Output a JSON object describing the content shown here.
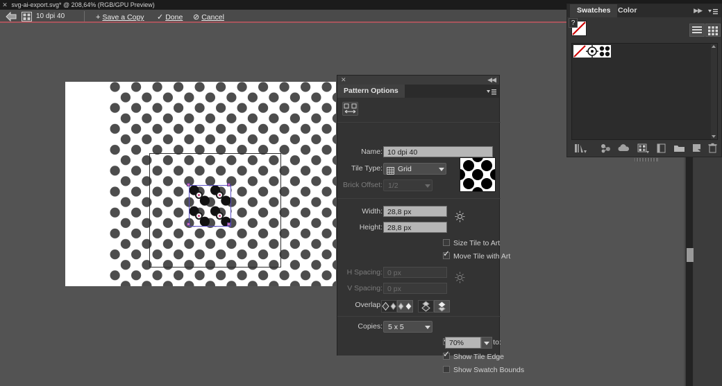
{
  "titlebar": {
    "close_icon": "close-icon",
    "document_title": "svg-ai-export.svg* @ 208,64% (RGB/GPU Preview)"
  },
  "appbar": {
    "back_icon": "back-arrow-icon",
    "tile_icon": "pattern-tile-icon",
    "pattern_name": "10 dpi 40",
    "save_copy_prefix": "+",
    "save_copy_label": "Save a Copy",
    "done_prefix": "✓",
    "done_label": "Done",
    "cancel_prefix": "⊘",
    "cancel_label": "Cancel"
  },
  "pattern_options": {
    "close_icon": "close-icon",
    "collapse_icon": "collapse-panel-icon",
    "tab_label": "Pattern Options",
    "menu_icon": "panel-menu-icon",
    "tile_tool_icon": "tile-edit-tool-icon",
    "name_label": "Name:",
    "name_value": "10 dpi 40",
    "tile_type_label": "Tile Type:",
    "tile_type_value": "Grid",
    "tile_type_icon": "grid-tile-icon",
    "brick_offset_label": "Brick Offset:",
    "brick_offset_value": "1/2",
    "width_label": "Width:",
    "width_value": "28,8 px",
    "height_label": "Height:",
    "height_value": "28,8 px",
    "link_icon": "link-dimensions-icon",
    "size_tile_label": "Size Tile to Art",
    "size_tile_checked": false,
    "move_tile_label": "Move Tile with Art",
    "move_tile_checked": true,
    "h_spacing_label": "H Spacing:",
    "h_spacing_value": "0 px",
    "v_spacing_label": "V Spacing:",
    "v_spacing_value": "0 px",
    "spacing_link_icon": "link-spacing-icon",
    "overlap_label": "Overlap:",
    "overlap_buttons": [
      {
        "name": "overlap-left-in-front",
        "selected": true
      },
      {
        "name": "overlap-right-in-front",
        "selected": false
      },
      {
        "name": "overlap-bottom-in-front",
        "selected": true
      },
      {
        "name": "overlap-top-in-front",
        "selected": false
      }
    ],
    "copies_label": "Copies:",
    "copies_value": "5 x 5",
    "dim_copies_label": "Dim Copies to:",
    "dim_copies_checked": true,
    "dim_copies_value": "70%",
    "show_tile_edge_label": "Show Tile Edge",
    "show_tile_edge_checked": true,
    "show_swatch_bounds_label": "Show Swatch Bounds",
    "show_swatch_bounds_checked": false,
    "preview_thumb_name": "pattern-preview-thumbnail"
  },
  "swatches_panel": {
    "tabs": [
      {
        "label": "Swatches",
        "active": true
      },
      {
        "label": "Color",
        "active": false
      }
    ],
    "expand_icon": "expand-arrows-icon",
    "menu_icon": "panel-menu-icon",
    "none_swatch_name": "none-swatch",
    "question_icon": "unknown-swatch-icon",
    "view_list_icon": "list-view-icon",
    "view_grid_icon": "grid-view-icon",
    "items": [
      {
        "name": "swatch-none",
        "kind": "none"
      },
      {
        "name": "swatch-registration-pattern",
        "kind": "pattern-small"
      },
      {
        "name": "swatch-dots-pattern",
        "kind": "pattern-dots"
      }
    ],
    "footer_buttons": [
      {
        "name": "swatch-libraries-button"
      },
      {
        "name": "color-guide-button"
      },
      {
        "name": "cloud-libraries-button"
      },
      {
        "name": "show-swatch-kinds-button"
      },
      {
        "name": "new-color-group-button"
      },
      {
        "name": "swatch-options-folder-button"
      },
      {
        "name": "new-swatch-button"
      },
      {
        "name": "delete-swatch-button"
      }
    ],
    "grip_name": "panel-resize-grip"
  },
  "canvas": {
    "artboard_name": "artboard",
    "pattern_name": "pattern-dots-artwork",
    "copies_bounds_name": "pattern-copies-bounds",
    "tile_edge_name": "pattern-tile-edge",
    "scrollbar_name": "vertical-scrollbar"
  },
  "colors": {
    "app_bg": "#535353",
    "panel_bg": "#333333",
    "accent_red": "#a8555c",
    "tile_edge": "#5a4fc4",
    "anchor": "#c96fb5",
    "dot_full": "#1a1a1a",
    "dot_dim": "#555555"
  }
}
